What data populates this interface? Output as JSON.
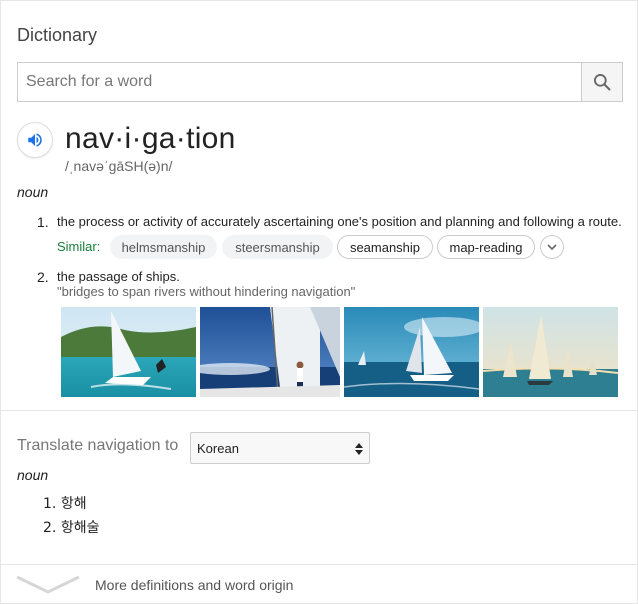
{
  "dictionary": {
    "title": "Dictionary",
    "search": {
      "placeholder": "Search for a word",
      "button_icon": "search-icon"
    },
    "entry": {
      "audio_icon": "speaker-icon",
      "headword": "nav·i·ga·tion",
      "phonetic": "/ˌnavəˈɡāSH(ə)n/",
      "part_of_speech": "noun",
      "definitions": [
        {
          "number": "1.",
          "text": "the process or activity of accurately ascertaining one's position and planning and following a route.",
          "similar_label": "Similar:",
          "similar": [
            "helmsmanship",
            "steersmanship",
            "seamanship",
            "map-reading"
          ]
        },
        {
          "number": "2.",
          "text": "the passage of ships.",
          "example": "\"bridges to span rivers without hindering navigation\""
        }
      ],
      "images": [
        "sailboat-racer",
        "sail-crew-deck",
        "sailboat-blue-sea",
        "regatta-sunset"
      ]
    },
    "translate": {
      "label": "Translate navigation to",
      "selected_language": "Korean",
      "part_of_speech": "noun",
      "items": [
        {
          "number": "1.",
          "text": "항해"
        },
        {
          "number": "2.",
          "text": "항해술"
        }
      ]
    },
    "more_link": "More definitions and word origin"
  },
  "colors": {
    "similar_label": "#188038",
    "audio_icon": "#1a73e8"
  }
}
